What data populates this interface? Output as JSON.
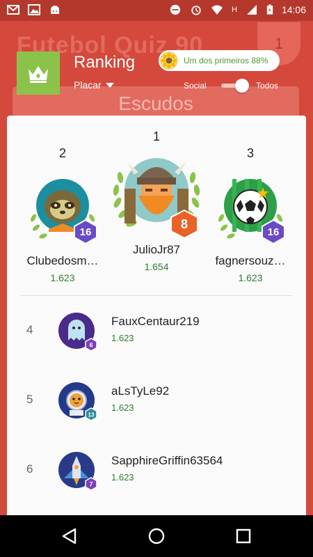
{
  "status_bar": {
    "time": "14:06",
    "signal_letter": "H"
  },
  "background": {
    "title": "Futebol Quiz 90",
    "badge": "1",
    "card_label": "Escudos"
  },
  "header": {
    "title": "Ranking",
    "filter_label": "Placar",
    "achievement": "Um dos primeiros 88%",
    "toggle_left": "Social",
    "toggle_right": "Todos",
    "toggle_state": "Todos"
  },
  "podium": [
    {
      "rank": "2",
      "name": "Clubedosm…",
      "score": "1.623",
      "level": "16",
      "avatar": "sloth-avatar",
      "level_color": "#6a4bc4"
    },
    {
      "rank": "1",
      "name": "JulioJr87",
      "score": "1.654",
      "level": "8",
      "avatar": "viking-avatar",
      "level_color": "#e8622a"
    },
    {
      "rank": "3",
      "name": "fagnersouz…",
      "score": "1.623",
      "level": "16",
      "avatar": "soccer-ball-avatar",
      "level_color": "#6a4bc4"
    }
  ],
  "list": [
    {
      "pos": "4",
      "name": "FauxCentaur219",
      "score": "1.623",
      "level": "6",
      "avatar": "ghost-avatar",
      "level_color": "#7b3fb8"
    },
    {
      "pos": "5",
      "name": "aLsTyLe92",
      "score": "1.623",
      "level": "13",
      "avatar": "astronaut-cat-avatar",
      "level_color": "#2a8d9a"
    },
    {
      "pos": "6",
      "name": "SapphireGriffin63564",
      "score": "1.623",
      "level": "7",
      "avatar": "spaceship-avatar",
      "level_color": "#7b3fb8"
    }
  ]
}
